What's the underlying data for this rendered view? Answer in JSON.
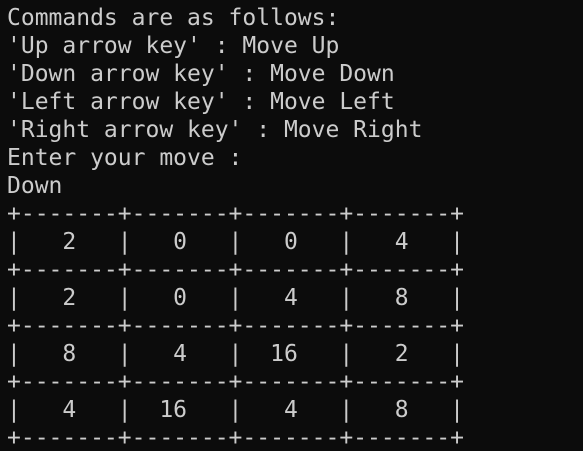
{
  "terminal": {
    "header_lines": [
      "Commands are as follows:",
      "'Up arrow key' : Move Up",
      "'Down arrow key' : Move Down",
      "'Left arrow key' : Move Left",
      "'Right arrow key' : Move Right",
      "Enter your move :",
      "Down"
    ],
    "board": {
      "separator": "+-------+-------+-------+-------+",
      "rows": [
        "|   2   |   0   |   0   |   4   |",
        "|   2   |   0   |   4   |   8   |",
        "|   8   |   4   |  16   |   2   |",
        "|   4   |  16   |   4   |   8   |"
      ],
      "values": [
        [
          2,
          0,
          0,
          4
        ],
        [
          2,
          0,
          4,
          8
        ],
        [
          8,
          4,
          16,
          2
        ],
        [
          4,
          16,
          4,
          8
        ]
      ]
    }
  }
}
